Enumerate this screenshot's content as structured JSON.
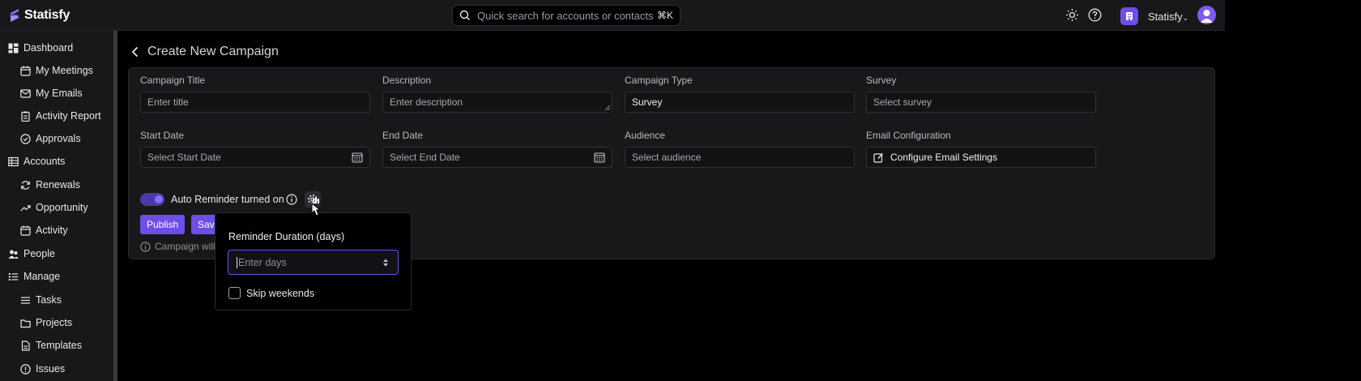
{
  "app": {
    "name": "Statisfy"
  },
  "search": {
    "placeholder": "Quick search for accounts or contacts",
    "shortcut": "⌘K"
  },
  "header": {
    "workspace": "Statisfy"
  },
  "sidebar": {
    "items": [
      {
        "label": "Dashboard",
        "icon": "dashboard-icon"
      },
      {
        "label": "My Meetings",
        "icon": "calendar-icon"
      },
      {
        "label": "My Emails",
        "icon": "mail-icon"
      },
      {
        "label": "Activity Report",
        "icon": "clipboard-icon"
      },
      {
        "label": "Approvals",
        "icon": "check-circle-icon"
      },
      {
        "label": "Accounts",
        "icon": "table-icon"
      },
      {
        "label": "Renewals",
        "icon": "refresh-icon"
      },
      {
        "label": "Opportunity",
        "icon": "trending-up-icon"
      },
      {
        "label": "Activity",
        "icon": "calendar-icon"
      },
      {
        "label": "People",
        "icon": "people-icon"
      },
      {
        "label": "Manage",
        "icon": "list-icon"
      },
      {
        "label": "Tasks",
        "icon": "checklist-icon"
      },
      {
        "label": "Projects",
        "icon": "folder-icon"
      },
      {
        "label": "Templates",
        "icon": "file-icon"
      },
      {
        "label": "Issues",
        "icon": "alert-icon"
      }
    ]
  },
  "page": {
    "title": "Create New Campaign"
  },
  "form": {
    "campaign_title": {
      "label": "Campaign Title",
      "placeholder": "Enter title"
    },
    "description": {
      "label": "Description",
      "placeholder": "Enter description"
    },
    "campaign_type": {
      "label": "Campaign Type",
      "value": "Survey"
    },
    "survey": {
      "label": "Survey",
      "placeholder": "Select survey"
    },
    "start_date": {
      "label": "Start Date",
      "placeholder": "Select Start Date"
    },
    "end_date": {
      "label": "End Date",
      "placeholder": "Select End Date"
    },
    "audience": {
      "label": "Audience",
      "placeholder": "Select audience"
    },
    "email_config": {
      "label": "Email Configuration",
      "button": "Configure Email Settings"
    },
    "auto_reminder": {
      "label": "Auto Reminder turned on",
      "enabled": true
    },
    "publish_label": "Publish",
    "save_label": "Save",
    "note": "Campaign will"
  },
  "popover": {
    "title": "Reminder Duration (days)",
    "input_placeholder": "Enter days",
    "skip_weekends_label": "Skip weekends",
    "skip_weekends_checked": false
  },
  "colors": {
    "accent": "#6d4ee6",
    "background": "#000000",
    "panel": "#18181b"
  }
}
